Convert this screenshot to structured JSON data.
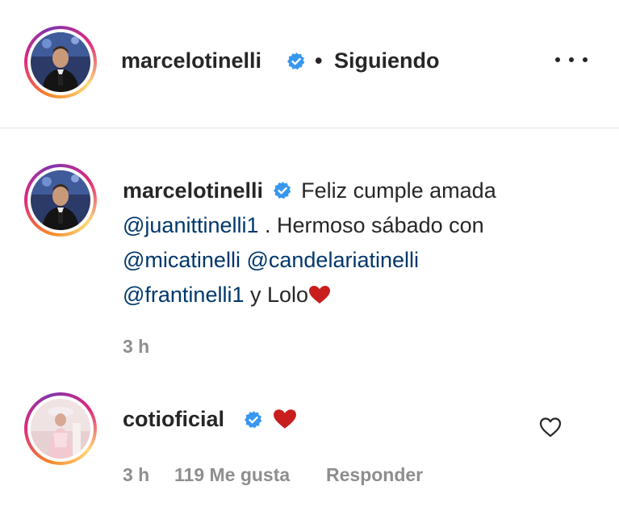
{
  "post_header": {
    "username": "marcelotinelli",
    "separator": "•",
    "follow_status": "Siguiendo",
    "verified_icon": "verified-badge-icon",
    "more_icon": "more-options-icon"
  },
  "caption": {
    "username": "marcelotinelli",
    "text_1": "Feliz cumple amada",
    "mention_1": "@juanittinelli1",
    "text_2": ". Hermoso sábado con",
    "mention_2": "@micatinelli",
    "mention_3": "@candelariatinelli",
    "mention_4": "@frantinelli1",
    "text_3": "y Lolo",
    "emoji": "red-heart-icon",
    "time": "3 h"
  },
  "comment": {
    "username": "cotioficial",
    "emoji": "red-heart-icon",
    "time": "3 h",
    "likes": "119 Me gusta",
    "reply_label": "Responder",
    "like_icon": "heart-outline-icon"
  },
  "colors": {
    "text": "#262626",
    "mention": "#00376b",
    "meta": "#8e8e8e",
    "verified": "#3897f0",
    "heart": "#c81e1e",
    "divider": "#e4e4e4"
  }
}
